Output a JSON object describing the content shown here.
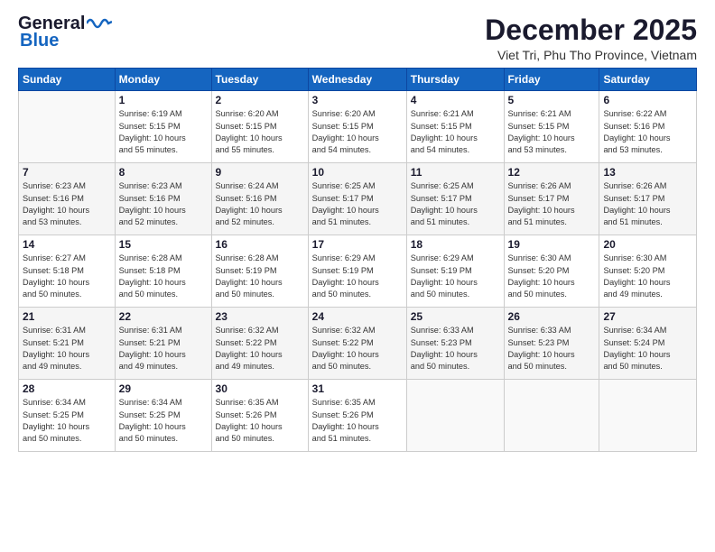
{
  "header": {
    "logo_line1": "General",
    "logo_line2": "Blue",
    "month": "December 2025",
    "location": "Viet Tri, Phu Tho Province, Vietnam"
  },
  "days_of_week": [
    "Sunday",
    "Monday",
    "Tuesday",
    "Wednesday",
    "Thursday",
    "Friday",
    "Saturday"
  ],
  "weeks": [
    [
      {
        "num": "",
        "info": ""
      },
      {
        "num": "1",
        "info": "Sunrise: 6:19 AM\nSunset: 5:15 PM\nDaylight: 10 hours\nand 55 minutes."
      },
      {
        "num": "2",
        "info": "Sunrise: 6:20 AM\nSunset: 5:15 PM\nDaylight: 10 hours\nand 55 minutes."
      },
      {
        "num": "3",
        "info": "Sunrise: 6:20 AM\nSunset: 5:15 PM\nDaylight: 10 hours\nand 54 minutes."
      },
      {
        "num": "4",
        "info": "Sunrise: 6:21 AM\nSunset: 5:15 PM\nDaylight: 10 hours\nand 54 minutes."
      },
      {
        "num": "5",
        "info": "Sunrise: 6:21 AM\nSunset: 5:15 PM\nDaylight: 10 hours\nand 53 minutes."
      },
      {
        "num": "6",
        "info": "Sunrise: 6:22 AM\nSunset: 5:16 PM\nDaylight: 10 hours\nand 53 minutes."
      }
    ],
    [
      {
        "num": "7",
        "info": "Sunrise: 6:23 AM\nSunset: 5:16 PM\nDaylight: 10 hours\nand 53 minutes."
      },
      {
        "num": "8",
        "info": "Sunrise: 6:23 AM\nSunset: 5:16 PM\nDaylight: 10 hours\nand 52 minutes."
      },
      {
        "num": "9",
        "info": "Sunrise: 6:24 AM\nSunset: 5:16 PM\nDaylight: 10 hours\nand 52 minutes."
      },
      {
        "num": "10",
        "info": "Sunrise: 6:25 AM\nSunset: 5:17 PM\nDaylight: 10 hours\nand 51 minutes."
      },
      {
        "num": "11",
        "info": "Sunrise: 6:25 AM\nSunset: 5:17 PM\nDaylight: 10 hours\nand 51 minutes."
      },
      {
        "num": "12",
        "info": "Sunrise: 6:26 AM\nSunset: 5:17 PM\nDaylight: 10 hours\nand 51 minutes."
      },
      {
        "num": "13",
        "info": "Sunrise: 6:26 AM\nSunset: 5:17 PM\nDaylight: 10 hours\nand 51 minutes."
      }
    ],
    [
      {
        "num": "14",
        "info": "Sunrise: 6:27 AM\nSunset: 5:18 PM\nDaylight: 10 hours\nand 50 minutes."
      },
      {
        "num": "15",
        "info": "Sunrise: 6:28 AM\nSunset: 5:18 PM\nDaylight: 10 hours\nand 50 minutes."
      },
      {
        "num": "16",
        "info": "Sunrise: 6:28 AM\nSunset: 5:19 PM\nDaylight: 10 hours\nand 50 minutes."
      },
      {
        "num": "17",
        "info": "Sunrise: 6:29 AM\nSunset: 5:19 PM\nDaylight: 10 hours\nand 50 minutes."
      },
      {
        "num": "18",
        "info": "Sunrise: 6:29 AM\nSunset: 5:19 PM\nDaylight: 10 hours\nand 50 minutes."
      },
      {
        "num": "19",
        "info": "Sunrise: 6:30 AM\nSunset: 5:20 PM\nDaylight: 10 hours\nand 50 minutes."
      },
      {
        "num": "20",
        "info": "Sunrise: 6:30 AM\nSunset: 5:20 PM\nDaylight: 10 hours\nand 49 minutes."
      }
    ],
    [
      {
        "num": "21",
        "info": "Sunrise: 6:31 AM\nSunset: 5:21 PM\nDaylight: 10 hours\nand 49 minutes."
      },
      {
        "num": "22",
        "info": "Sunrise: 6:31 AM\nSunset: 5:21 PM\nDaylight: 10 hours\nand 49 minutes."
      },
      {
        "num": "23",
        "info": "Sunrise: 6:32 AM\nSunset: 5:22 PM\nDaylight: 10 hours\nand 49 minutes."
      },
      {
        "num": "24",
        "info": "Sunrise: 6:32 AM\nSunset: 5:22 PM\nDaylight: 10 hours\nand 50 minutes."
      },
      {
        "num": "25",
        "info": "Sunrise: 6:33 AM\nSunset: 5:23 PM\nDaylight: 10 hours\nand 50 minutes."
      },
      {
        "num": "26",
        "info": "Sunrise: 6:33 AM\nSunset: 5:23 PM\nDaylight: 10 hours\nand 50 minutes."
      },
      {
        "num": "27",
        "info": "Sunrise: 6:34 AM\nSunset: 5:24 PM\nDaylight: 10 hours\nand 50 minutes."
      }
    ],
    [
      {
        "num": "28",
        "info": "Sunrise: 6:34 AM\nSunset: 5:25 PM\nDaylight: 10 hours\nand 50 minutes."
      },
      {
        "num": "29",
        "info": "Sunrise: 6:34 AM\nSunset: 5:25 PM\nDaylight: 10 hours\nand 50 minutes."
      },
      {
        "num": "30",
        "info": "Sunrise: 6:35 AM\nSunset: 5:26 PM\nDaylight: 10 hours\nand 50 minutes."
      },
      {
        "num": "31",
        "info": "Sunrise: 6:35 AM\nSunset: 5:26 PM\nDaylight: 10 hours\nand 51 minutes."
      },
      {
        "num": "",
        "info": ""
      },
      {
        "num": "",
        "info": ""
      },
      {
        "num": "",
        "info": ""
      }
    ]
  ]
}
